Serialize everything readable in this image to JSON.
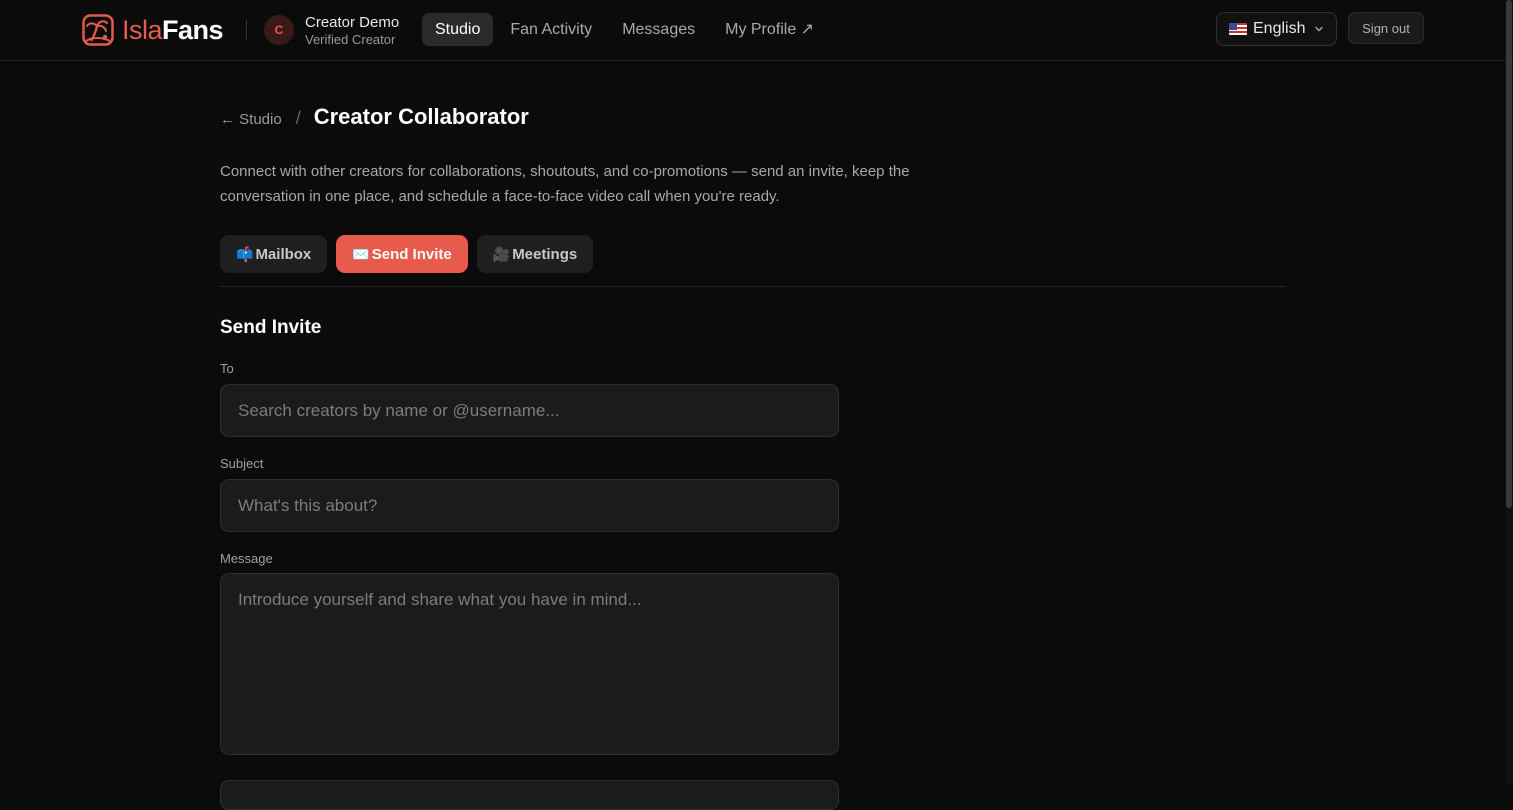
{
  "brand": {
    "isla": "Isla",
    "fans": "Fans",
    "accent": "#e65b4b"
  },
  "user": {
    "initial": "C",
    "name": "Creator Demo",
    "role": "Verified Creator"
  },
  "nav": [
    {
      "label": "Studio",
      "active": true
    },
    {
      "label": "Fan Activity",
      "active": false
    },
    {
      "label": "Messages",
      "active": false
    },
    {
      "label": "My Profile ↗",
      "active": false
    }
  ],
  "language": {
    "label": "English",
    "icon": "us-flag-icon"
  },
  "signout_label": "Sign out",
  "breadcrumb": {
    "back_label": "← Studio",
    "separator": "/",
    "title": "Creator Collaborator"
  },
  "description": "Connect with other creators for collaborations, shoutouts, and co-promotions — send an invite, keep the conversation in one place, and schedule a face-to-face video call when you're ready.",
  "tabs": [
    {
      "icon": "📫",
      "label": "Mailbox",
      "active": false
    },
    {
      "icon": "✉️",
      "label": "Send Invite",
      "active": true
    },
    {
      "icon": "🎥",
      "label": "Meetings",
      "active": false
    }
  ],
  "form": {
    "title": "Send Invite",
    "to": {
      "label": "To",
      "placeholder": "Search creators by name or @username...",
      "value": ""
    },
    "subject": {
      "label": "Subject",
      "placeholder": "What's this about?",
      "value": ""
    },
    "message": {
      "label": "Message",
      "placeholder": "Introduce yourself and share what you have in mind...",
      "value": ""
    }
  }
}
